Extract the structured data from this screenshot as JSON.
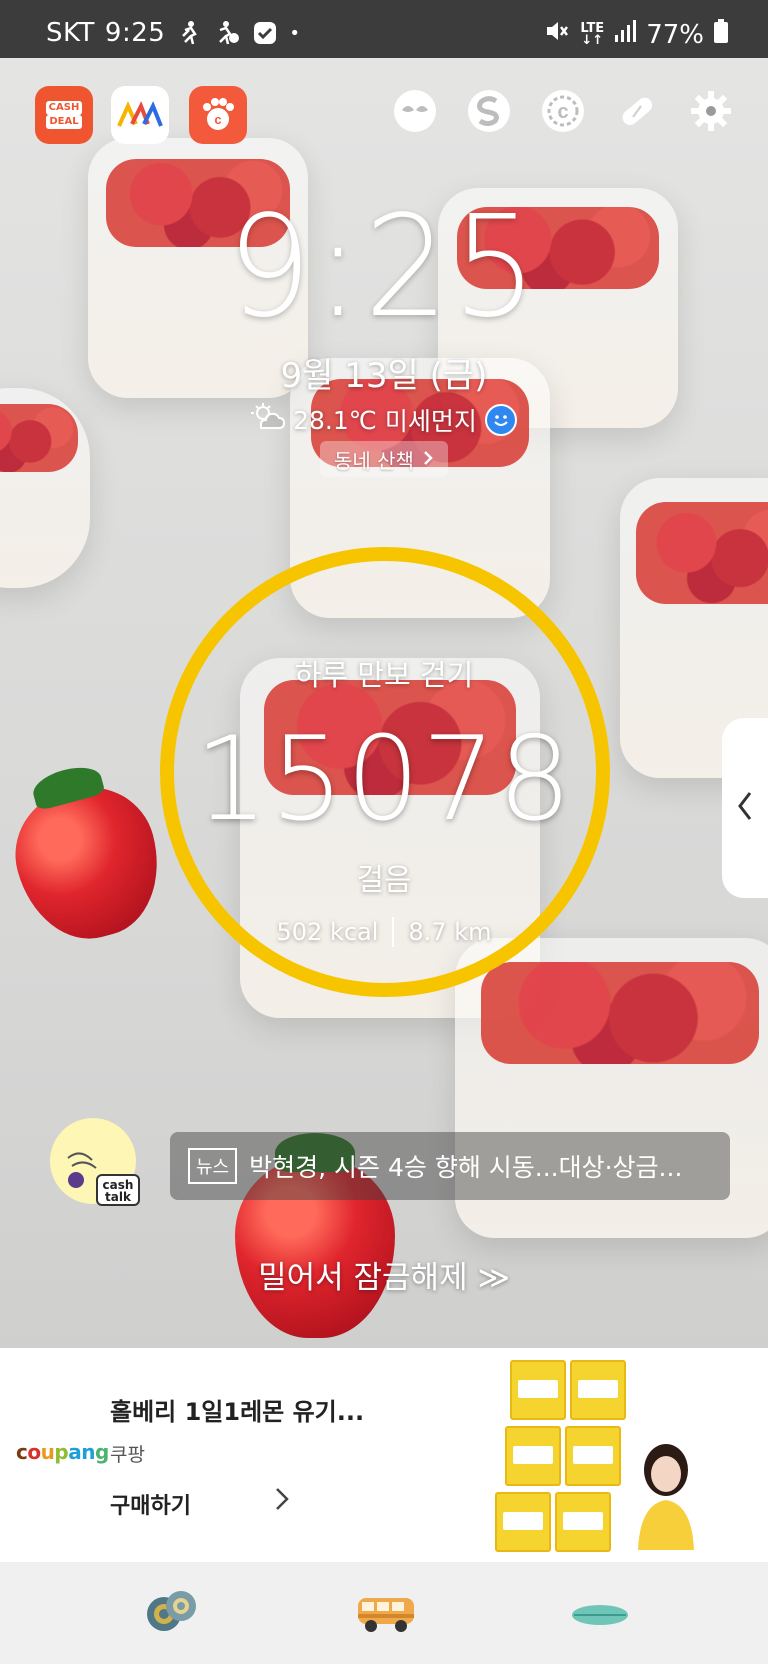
{
  "status_bar": {
    "carrier": "SKT",
    "time": "9:25",
    "network": "LTE",
    "battery": "77%",
    "icons": [
      "runner-icon",
      "cash-runner-icon",
      "shield-check-icon",
      "dot-icon",
      "mute-icon",
      "lte-icon",
      "signal-icon",
      "battery-icon"
    ]
  },
  "shortcuts": {
    "left": [
      {
        "name": "cashdeal",
        "label_top": "CASH",
        "label_bottom": "DEAL",
        "color": "#ef5630"
      },
      {
        "name": "mmm-app",
        "color": "#ffffff"
      },
      {
        "name": "paw-app",
        "color": "#f25a3b"
      }
    ],
    "right": [
      "mask-icon",
      "s-logo-icon",
      "c-coin-icon",
      "pill-icon",
      "gear-icon"
    ]
  },
  "clock": {
    "time": "9:25",
    "date": "9월 13일 (금)"
  },
  "weather": {
    "temp": "28.1℃",
    "dust": "미세먼지",
    "icon": "partly-cloudy-icon",
    "dust_icon": "smiley-icon"
  },
  "walk_chip": "동네 산책",
  "steps": {
    "title": "하루 만보 걷기",
    "count": "15078",
    "unit": "걸음",
    "kcal": "502 kcal",
    "distance": "8.7 km",
    "ring_color": "#f7c500"
  },
  "news": {
    "badge": "뉴스",
    "headline": "박현경, 시즌 4승 향해 시동...대상·상금..."
  },
  "cashtalk": {
    "label_top": "cash",
    "label_bottom": "talk"
  },
  "unlock": "밀어서 잠금해제 ≫",
  "ad": {
    "brand": "coupang",
    "title": "홀베리 1일1레몬 유기...",
    "seller": "쿠팡",
    "cta": "구매하기"
  },
  "dock": [
    "coins-icon",
    "van-icon",
    "surfboard-icon"
  ]
}
